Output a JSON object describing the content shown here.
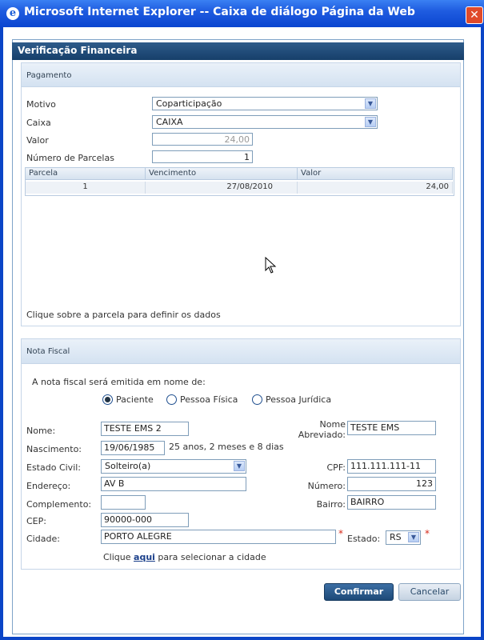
{
  "window": {
    "title": "Microsoft Internet Explorer -- Caixa de diálogo Página da Web",
    "close": "✕",
    "ie_icon": "e"
  },
  "dialog": {
    "title": "Verificação Financeira"
  },
  "pagamento": {
    "title": "Pagamento",
    "motivo": {
      "label": "Motivo",
      "value": "Coparticipação"
    },
    "caixa": {
      "label": "Caixa",
      "value": "CAIXA"
    },
    "valor": {
      "label": "Valor",
      "value": "24,00"
    },
    "parcelas": {
      "label": "Número de Parcelas",
      "value": "1"
    },
    "table": {
      "headers": [
        "Parcela",
        "Vencimento",
        "Valor"
      ],
      "rows": [
        [
          "1",
          "27/08/2010",
          "24,00"
        ]
      ]
    },
    "hint": "Clique sobre a parcela para definir os dados"
  },
  "nota_fiscal": {
    "title": "Nota Fiscal",
    "emitida_label": "A nota fiscal será emitida em nome de:",
    "options": [
      "Paciente",
      "Pessoa Física",
      "Pessoa Jurídica"
    ],
    "selected_option": "Paciente",
    "nome": {
      "label": "Nome:",
      "value": "TESTE EMS 2"
    },
    "nome_abreviado": {
      "label_line1": "Nome",
      "label_line2": "Abreviado:",
      "value": "TESTE EMS"
    },
    "nascimento": {
      "label": "Nascimento:",
      "value": "19/06/1985",
      "idade": "25 anos, 2 meses e 8 dias"
    },
    "estado_civil": {
      "label": "Estado Civil:",
      "value": "Solteiro(a)"
    },
    "cpf": {
      "label": "CPF:",
      "value": "111.111.111-11"
    },
    "endereco": {
      "label": "Endereço:",
      "value": "AV B"
    },
    "numero": {
      "label": "Número:",
      "value": "123"
    },
    "complemento": {
      "label": "Complemento:",
      "value": ""
    },
    "bairro": {
      "label": "Bairro:",
      "value": "BAIRRO"
    },
    "cep": {
      "label": "CEP:",
      "value": "90000-000"
    },
    "cidade": {
      "label": "Cidade:",
      "value": "PORTO ALEGRE"
    },
    "estado": {
      "label": "Estado:",
      "value": "RS"
    },
    "required_mark": "*",
    "cidade_hint": {
      "before": "Clique",
      "link": "aqui",
      "after": "para selecionar a cidade"
    }
  },
  "buttons": {
    "confirmar": "Confirmar",
    "cancelar": "Cancelar"
  },
  "icons": {
    "dropdown": "chevron-down-icon",
    "cursor": "mouse-pointer-icon"
  },
  "colors": {
    "titlebar": "#1f5ce0",
    "dialog_header": "#1f4a78",
    "panel_head": "#d4e2f1",
    "required": "#d62a1a"
  }
}
